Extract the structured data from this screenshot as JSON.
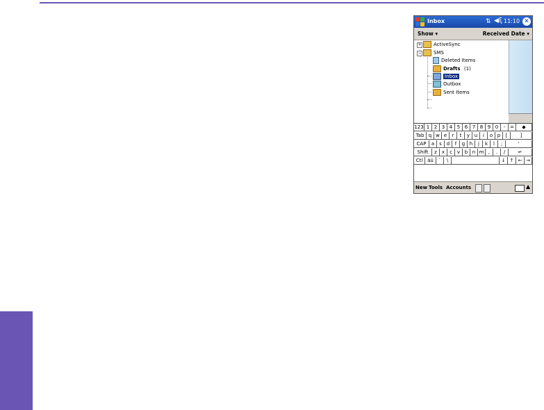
{
  "device": {
    "title": "Inbox",
    "time": "11:10",
    "sync_glyph": "⇅",
    "speaker_glyph": "◀ξ",
    "close_glyph": "✕",
    "menu": {
      "show": "Show ▾",
      "sort": "Received Date ▾"
    },
    "folders": [
      {
        "label": "ActiveSync",
        "expander": "+",
        "bold": false,
        "selected": false,
        "icon": "sync-folder-icon"
      },
      {
        "label": "SMS",
        "expander": "−",
        "bold": false,
        "selected": false,
        "icon": "sync-folder-icon"
      },
      {
        "label": "Deleted Items",
        "bold": false,
        "selected": false,
        "icon": "trash-icon"
      },
      {
        "label": "Drafts",
        "count": "(1)",
        "bold": true,
        "selected": false,
        "icon": "folder-icon"
      },
      {
        "label": "Inbox",
        "bold": false,
        "selected": true,
        "icon": "inbox-icon"
      },
      {
        "label": "Outbox",
        "bold": false,
        "selected": false,
        "icon": "outbox-icon"
      },
      {
        "label": "Sent Items",
        "bold": false,
        "selected": false,
        "icon": "folder-icon"
      }
    ],
    "keyboard": {
      "row1": [
        "123",
        "1",
        "2",
        "3",
        "4",
        "5",
        "6",
        "7",
        "8",
        "9",
        "0",
        "-",
        "=",
        "◆"
      ],
      "row2": [
        "Tab",
        "q",
        "w",
        "e",
        "r",
        "t",
        "y",
        "u",
        "i",
        "o",
        "p",
        "[",
        "]"
      ],
      "row3": [
        "CAP",
        "a",
        "s",
        "d",
        "f",
        "g",
        "h",
        "j",
        "k",
        "l",
        ";",
        "'"
      ],
      "row4": [
        "Shift",
        "z",
        "x",
        "c",
        "v",
        "b",
        "n",
        "m",
        ",",
        ".",
        "/",
        "↵"
      ],
      "row5": [
        "Ctl",
        "áü",
        "`",
        "\\",
        "",
        "↓",
        "↑",
        "←",
        "→"
      ]
    },
    "commands": {
      "new": "New",
      "tools": "Tools",
      "accounts": "Accounts",
      "kbd_arrow": "▲"
    }
  }
}
